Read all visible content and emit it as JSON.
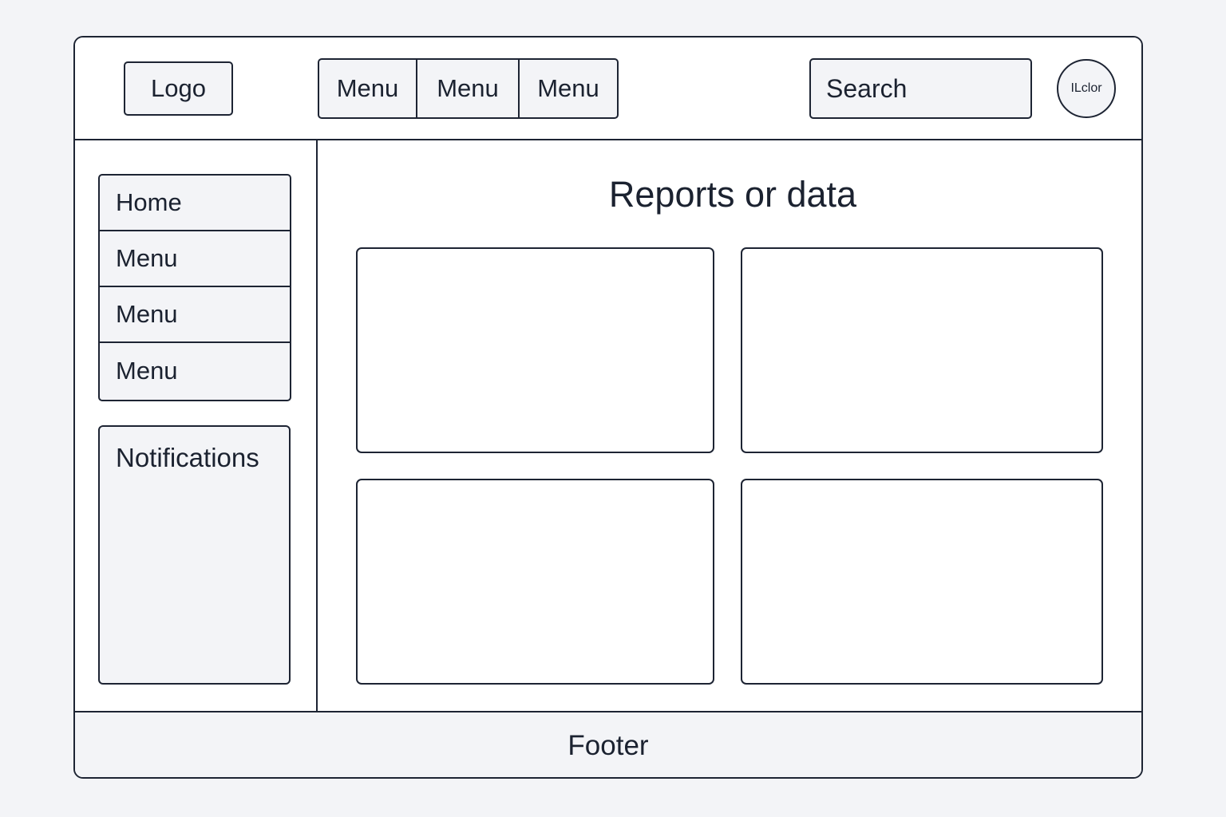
{
  "header": {
    "logo_label": "Logo",
    "nav": [
      "Menu",
      "Menu",
      "Menu"
    ],
    "search_label": "Search",
    "avatar_label": "ILclor"
  },
  "sidebar": {
    "items": [
      "Home",
      "Menu",
      "Menu",
      "Menu"
    ],
    "notifications_title": "Notifications"
  },
  "main": {
    "title": "Reports or data",
    "cards": [
      "",
      "",
      "",
      ""
    ]
  },
  "footer": {
    "label": "Footer"
  },
  "colors": {
    "border": "#1d2433",
    "page_background": "#f3f4f7",
    "panel_background": "#ffffff",
    "text": "#1b2230"
  }
}
